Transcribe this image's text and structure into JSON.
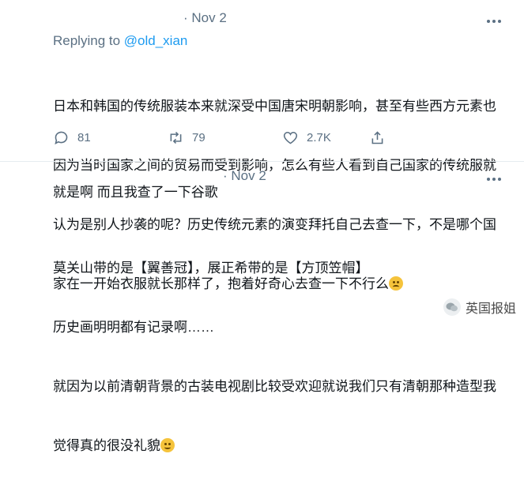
{
  "tweet1": {
    "date": "· Nov 2",
    "replying_prefix": "Replying to ",
    "replying_to": "@old_xian",
    "text_lines": [
      "日本和韩国的传统服装本来就深受中国唐宋明朝影响，甚至有些西方元素也",
      "因为当时国家之间的贸易而受到影响，怎么有些人看到自己国家的传统服就",
      "认为是别人抄袭的呢？历史传统元素的演变拜托自己去查一下，不是哪个国",
      "家在一开始衣服就长那样了，抱着好奇心去查一下不行么"
    ],
    "replies": "81",
    "retweets": "79",
    "likes": "2.7K"
  },
  "tweet2": {
    "date": "· Nov 2",
    "line1": "就是啊 而且我查了一下谷歌",
    "line2": "莫关山带的是【翼善冠】，展正希带的是【方顶笠帽】",
    "line3": "历史画明明都有记录啊……",
    "line4": "就因为以前清朝背景的古装电视剧比较受欢迎就说我们只有清朝那种造型我",
    "line5": "觉得真的很没礼貌"
  },
  "watermark": {
    "label": "英国报姐"
  },
  "colors": {
    "accent": "#1d9bf0",
    "secondary_text": "#5b7083",
    "divider": "#e6ecf0"
  },
  "icons": [
    "more-icon",
    "reply-icon",
    "retweet-icon",
    "like-icon",
    "share-icon",
    "wechat-logo-icon"
  ]
}
